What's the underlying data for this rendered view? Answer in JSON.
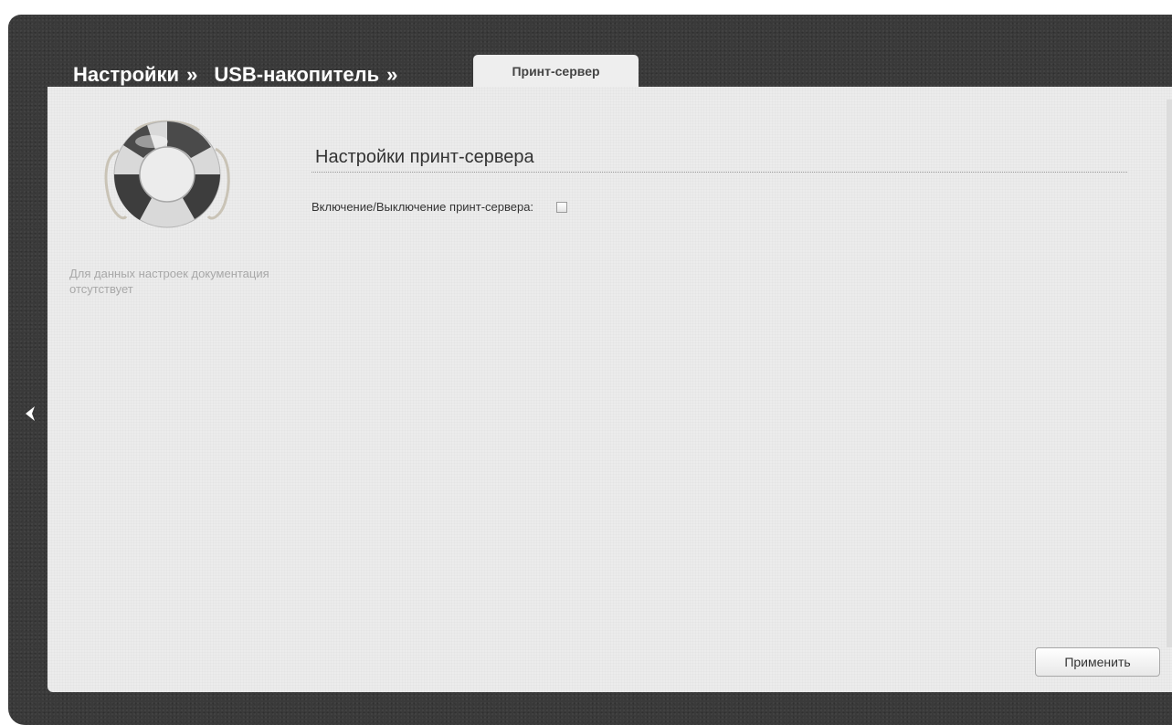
{
  "breadcrumb": {
    "items": [
      {
        "label": "Настройки",
        "separator": "»"
      },
      {
        "label": "USB-накопитель",
        "separator": "»"
      }
    ],
    "active_tab": "Принт-сервер"
  },
  "help": {
    "icon": "lifebuoy-icon",
    "text": "Для данных настроек документация отсутствует"
  },
  "section": {
    "title": "Настройки принт-сервера",
    "enable_label": "Включение/Выключение принт-сервера:",
    "enable_checked": false
  },
  "actions": {
    "apply_label": "Применить"
  },
  "nav": {
    "back_icon": "chevron-left-icon"
  }
}
